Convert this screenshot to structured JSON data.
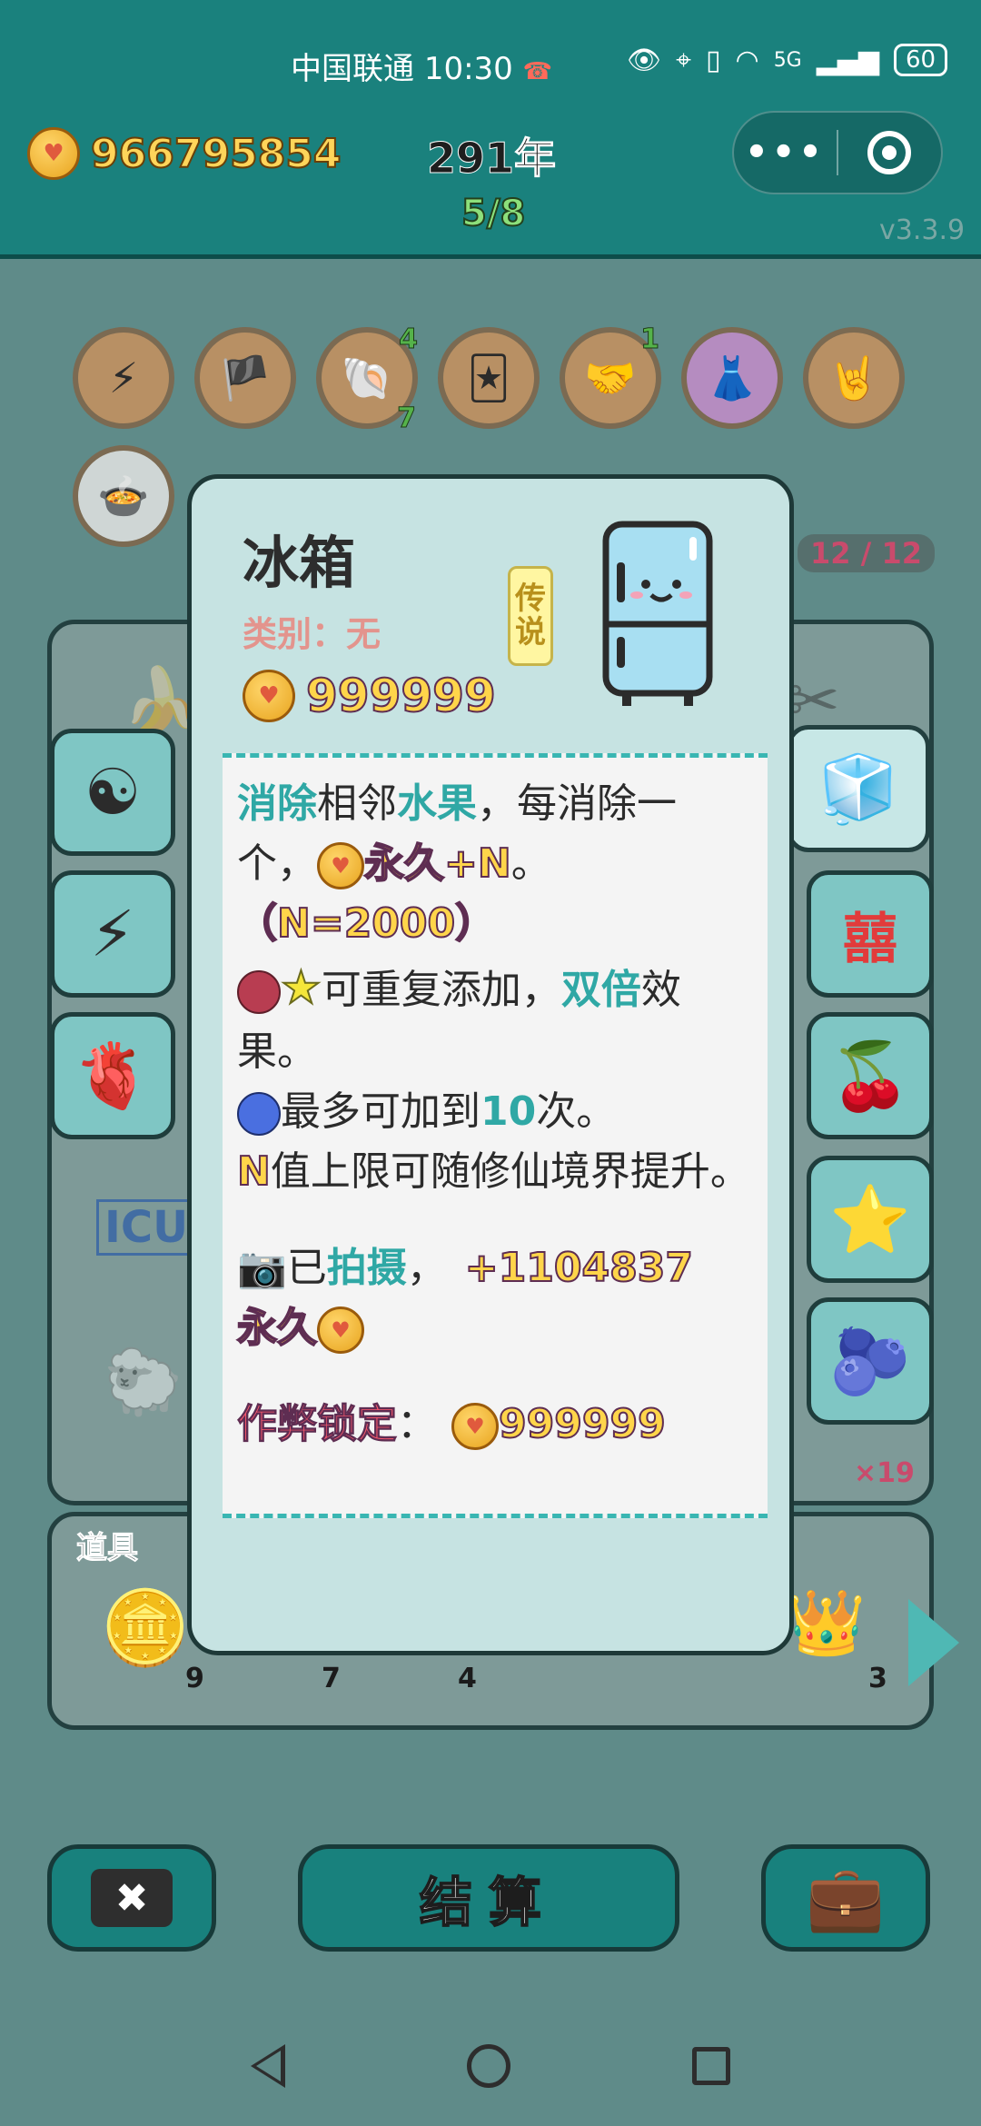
{
  "status_bar": {
    "carrier": "中国联通",
    "time": "10:30",
    "network": "5G",
    "battery": "60"
  },
  "header": {
    "money": "966795854",
    "year": "291年",
    "stage": "5/8",
    "menu_dots": "•••",
    "version": "v3.3.9"
  },
  "board": {
    "counter": "12 / 12",
    "multiplier": "×19",
    "icu_label": "ICU"
  },
  "tools": {
    "title": "道具",
    "counts": [
      "9",
      "7",
      "4",
      "3"
    ]
  },
  "buttons": {
    "cancel_glyph": "✖",
    "settle_label": "结算"
  },
  "modal": {
    "title": "冰箱",
    "category": "类别：无",
    "tag_line1": "传",
    "tag_line2": "说",
    "price": "999999",
    "desc": {
      "p1_a": "消除",
      "p1_b": "相邻",
      "p1_c": "水果",
      "p1_d": "，每消除一个，",
      "p1_e": "永久+N",
      "p1_f": "。",
      "p2": "（N=2000）",
      "p3_a": "可重复添加，",
      "p3_b": "双倍",
      "p3_c": "效果。",
      "p4_a": "最多可加到",
      "p4_b": "10",
      "p4_c": "次。",
      "p5_a": "N",
      "p5_b": "值上限可随修仙境界提升。",
      "p6_a": "已",
      "p6_b": "拍摄",
      "p6_c": "，",
      "p6_d": "+1104837",
      "p6_e": "永久",
      "p7_a": "作弊锁定",
      "p7_b": "：",
      "p7_c": "999999"
    }
  }
}
